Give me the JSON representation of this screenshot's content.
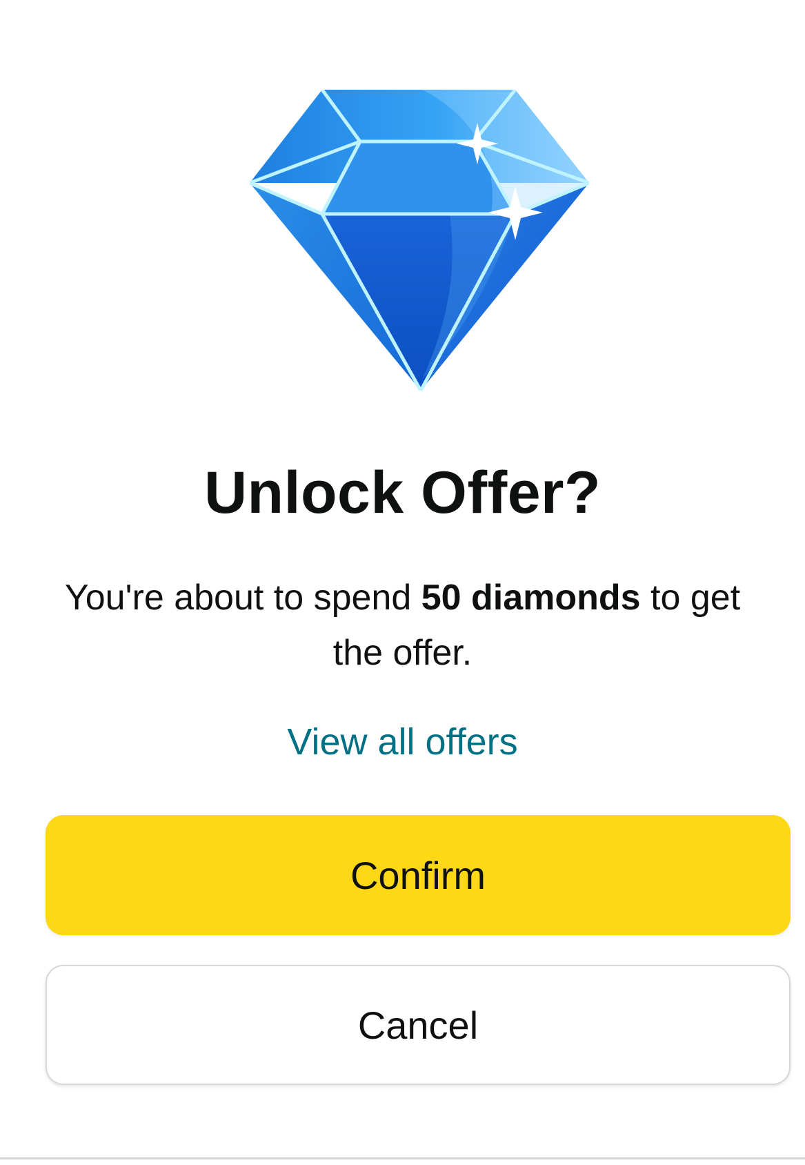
{
  "dialog": {
    "icon": "diamond-icon",
    "title": "Unlock Offer?",
    "message": {
      "prefix": "You're about to spend ",
      "emphasis": "50 diamonds",
      "suffix": " to get the offer."
    },
    "link_label": "View all offers",
    "confirm_label": "Confirm",
    "cancel_label": "Cancel"
  },
  "colors": {
    "confirm_button": "#FCD817",
    "link": "#007185",
    "diamond": "#1E88E5"
  }
}
